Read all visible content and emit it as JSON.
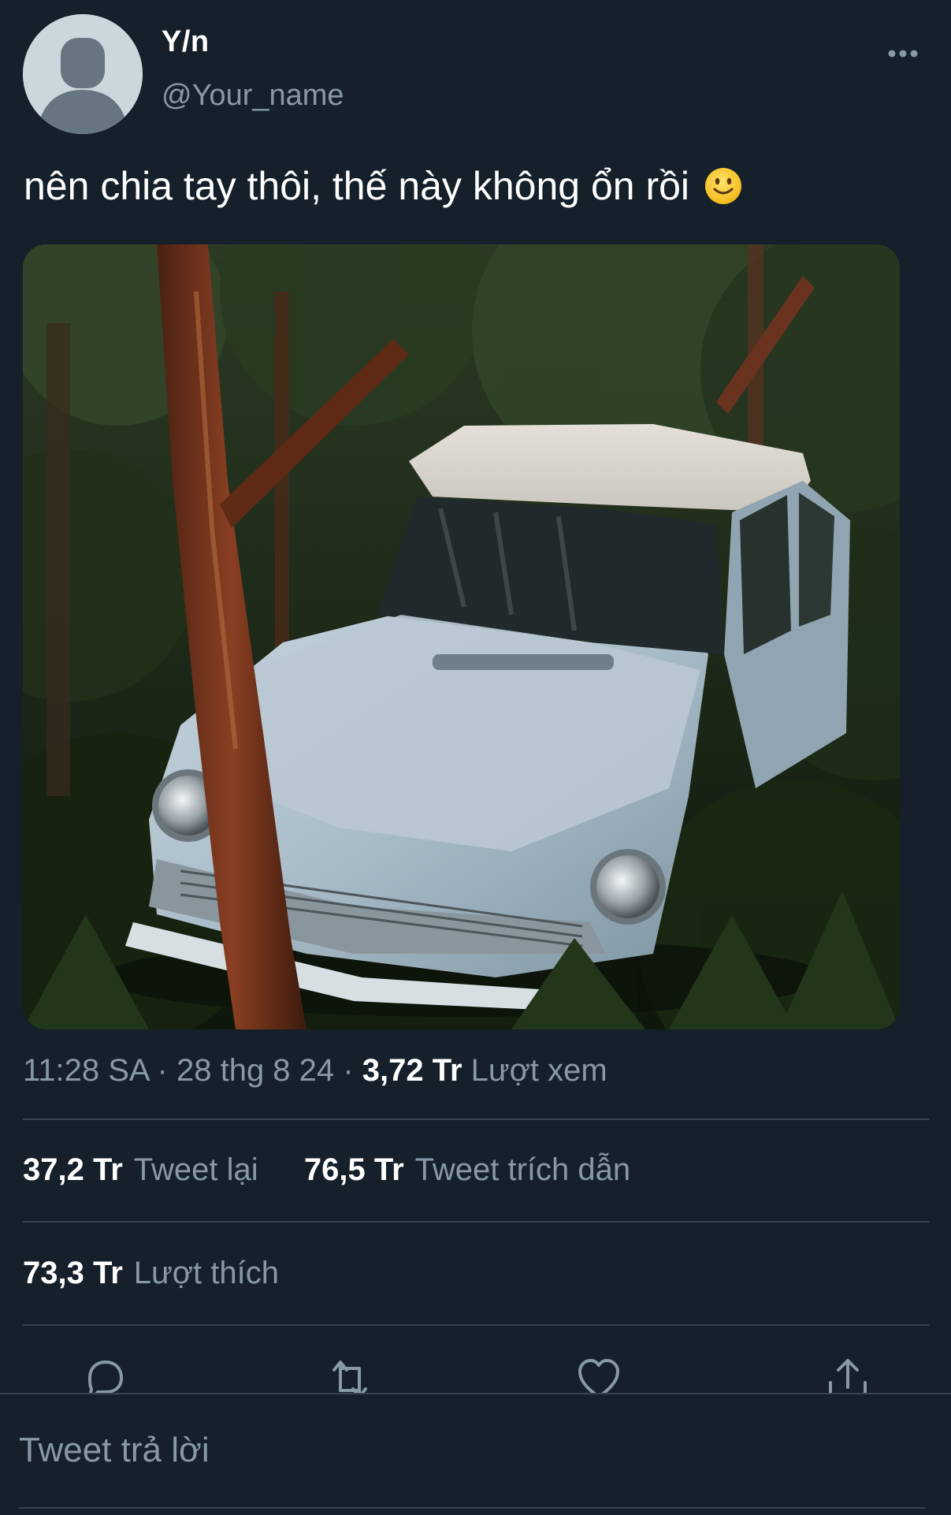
{
  "tweet": {
    "author": {
      "display_name": "Y/n",
      "handle": "@Your_name",
      "avatar_icon": "default-avatar-icon"
    },
    "more_icon": "more-horizontal-icon",
    "text": "nên chia tay thôi, thế này không ổn rồi",
    "emoji": "slightly-smiling-face",
    "media": {
      "icon": "photo-car-in-tree"
    },
    "meta": {
      "time": "11:28 SA",
      "separator": "·",
      "date": "28 thg 8 24",
      "views_count": "3,72 Tr",
      "views_label": "Lượt xem"
    },
    "stats": {
      "retweets_count": "37,2 Tr",
      "retweets_label": "Tweet lại",
      "quotes_count": "76,5 Tr",
      "quotes_label": "Tweet trích dẫn",
      "likes_count": "73,3 Tr",
      "likes_label": "Lượt thích"
    },
    "actions": {
      "reply_icon": "reply-icon",
      "retweet_icon": "retweet-icon",
      "like_icon": "heart-icon",
      "share_icon": "share-icon"
    }
  },
  "reply": {
    "placeholder": "Tweet trả lời"
  },
  "colors": {
    "background": "#15202b",
    "secondary_text": "#8899a6",
    "divider": "#38444d"
  }
}
